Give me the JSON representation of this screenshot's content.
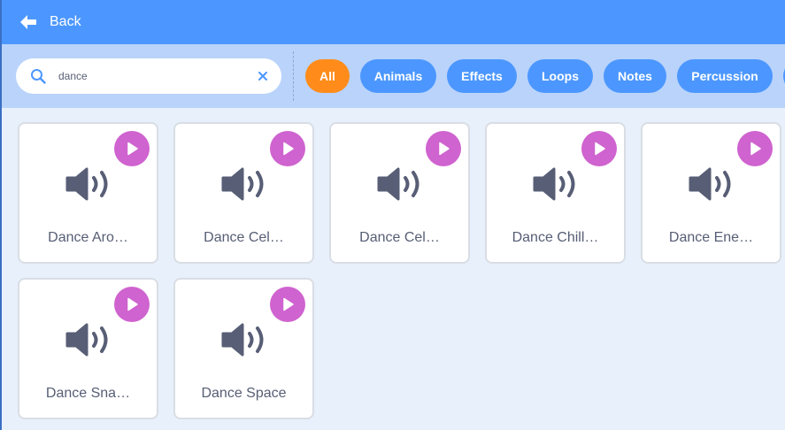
{
  "header": {
    "back_label": "Back"
  },
  "search": {
    "value": "dance"
  },
  "tags": [
    "All",
    "Animals",
    "Effects",
    "Loops",
    "Notes",
    "Percussion"
  ],
  "sounds": [
    "Dance Aro…",
    "Dance Cel…",
    "Dance Cel…",
    "Dance Chill…",
    "Dance Ene…",
    "Dance Sna…",
    "Dance Space"
  ],
  "colors": {
    "header": "#4c97ff",
    "filterbar": "#b9d3fb",
    "tag": "#4c97ff",
    "tag_active": "#ff8c1a",
    "play": "#cf63cf",
    "speaker": "#575e75"
  },
  "icons": {
    "back": "back-arrow-icon",
    "search": "search-icon",
    "clear": "close-icon",
    "play": "play-icon",
    "sound": "speaker-icon"
  }
}
